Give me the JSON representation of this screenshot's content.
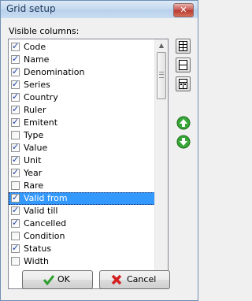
{
  "window": {
    "title": "Grid setup",
    "close_glyph": "✕"
  },
  "panel": {
    "label": "Visible columns:"
  },
  "columns": [
    {
      "label": "Code",
      "checked": true
    },
    {
      "label": "Name",
      "checked": true
    },
    {
      "label": "Denomination",
      "checked": true
    },
    {
      "label": "Series",
      "checked": true
    },
    {
      "label": "Country",
      "checked": true
    },
    {
      "label": "Ruler",
      "checked": true
    },
    {
      "label": "Emitent",
      "checked": true
    },
    {
      "label": "Type",
      "checked": false
    },
    {
      "label": "Value",
      "checked": true
    },
    {
      "label": "Unit",
      "checked": true
    },
    {
      "label": "Year",
      "checked": true
    },
    {
      "label": "Rare",
      "checked": false
    },
    {
      "label": "Valid from",
      "checked": true,
      "selected": true
    },
    {
      "label": "Valid till",
      "checked": true
    },
    {
      "label": "Cancelled",
      "checked": true
    },
    {
      "label": "Condition",
      "checked": false
    },
    {
      "label": "Status",
      "checked": true
    },
    {
      "label": "Width",
      "checked": false
    }
  ],
  "side_buttons": [
    {
      "name": "grid-layout-1-icon"
    },
    {
      "name": "grid-layout-2-icon"
    },
    {
      "name": "grid-layout-3-icon"
    }
  ],
  "move_buttons": {
    "up_icon": "green-arrow-up-icon",
    "down_icon": "green-arrow-down-icon"
  },
  "buttons": {
    "ok_label": "OK",
    "cancel_label": "Cancel"
  },
  "colors": {
    "selection": "#3399ff",
    "green": "#2e9e2e",
    "red": "#d42020"
  }
}
